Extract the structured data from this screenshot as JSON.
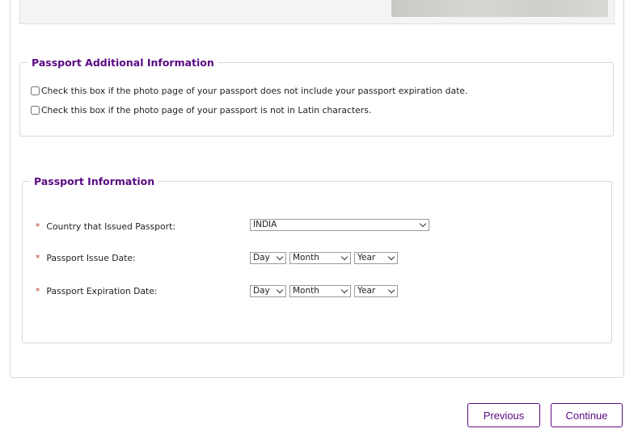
{
  "additional": {
    "title": "Passport Additional Information",
    "checks": [
      "Check this box if the photo page of your passport does not include your passport expiration date.",
      "Check this box if the photo page of your passport is not in Latin characters."
    ]
  },
  "passport": {
    "title": "Passport Information",
    "required_marker": "*",
    "country_label": "Country that Issued Passport:",
    "country_value": "INDIA",
    "issue_label": "Passport Issue Date:",
    "expiry_label": "Passport Expiration Date:",
    "day_placeholder": "Day",
    "month_placeholder": "Month",
    "year_placeholder": "Year"
  },
  "buttons": {
    "previous": "Previous",
    "continue": "Continue"
  },
  "colors": {
    "accent": "#5a0a82",
    "required": "#c0392b"
  }
}
